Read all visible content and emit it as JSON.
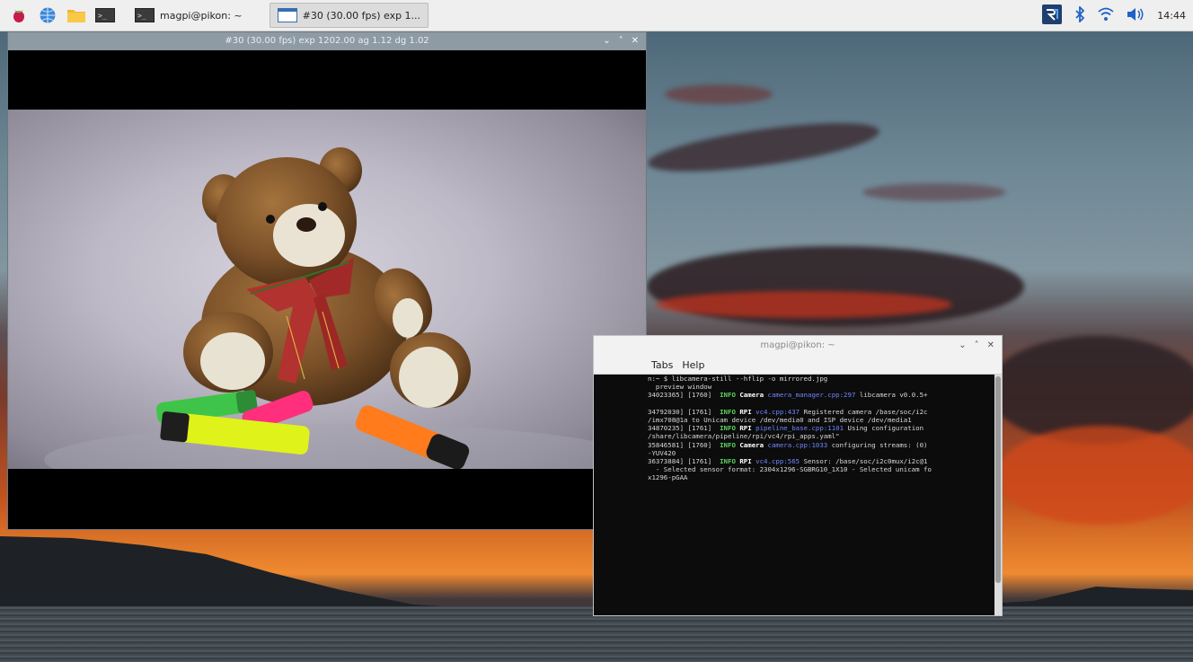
{
  "taskbar": {
    "icons": [
      "raspberry-menu-icon",
      "web-browser-icon",
      "file-manager-icon",
      "terminal-launcher-icon"
    ],
    "tasks": [
      {
        "label": "magpi@pikon: ~",
        "icon": "terminal-icon"
      },
      {
        "label": "#30 (30.00 fps) exp 1...",
        "icon": "window-icon"
      }
    ],
    "tray": {
      "vnc": "vnc-icon",
      "bluetooth": "bluetooth-icon",
      "wifi": "wifi-icon",
      "volume": "volume-icon"
    },
    "clock": "14:44"
  },
  "preview_window": {
    "title": "#30 (30.00 fps) exp 1202.00 ag 1.12 dg 1.02",
    "controls": [
      "⌄",
      "˄",
      "✕"
    ]
  },
  "terminal_window": {
    "title": "magpi@pikon: ~",
    "controls": [
      "⌄",
      "˄",
      "✕"
    ],
    "menu": [
      "Tabs",
      "Help"
    ],
    "lines": [
      {
        "parts": [
          {
            "t": "n:~ $ libcamera-still --hflip -o mirrored.jpg",
            "c": ""
          }
        ]
      },
      {
        "parts": [
          {
            "t": "  preview window",
            "c": ""
          }
        ]
      },
      {
        "parts": [
          {
            "t": "34023365] [1760]  ",
            "c": ""
          },
          {
            "t": "INFO ",
            "c": "c-grn"
          },
          {
            "t": "Camera ",
            "c": "c-wht"
          },
          {
            "t": "camera_manager.cpp:297 ",
            "c": "c-blu"
          },
          {
            "t": "libcamera v0.0.5+",
            "c": ""
          }
        ]
      },
      {
        "parts": [
          {
            "t": "",
            "c": ""
          }
        ]
      },
      {
        "parts": [
          {
            "t": "34792030] [1761]  ",
            "c": ""
          },
          {
            "t": "INFO ",
            "c": "c-grn"
          },
          {
            "t": "RPI ",
            "c": "c-wht"
          },
          {
            "t": "vc4.cpp:437 ",
            "c": "c-blu"
          },
          {
            "t": "Registered camera /base/soc/i2c",
            "c": ""
          }
        ]
      },
      {
        "parts": [
          {
            "t": "/imx708@1a to Unicam device /dev/media0 and ISP device /dev/media1",
            "c": ""
          }
        ]
      },
      {
        "parts": [
          {
            "t": "34870235] [1761]  ",
            "c": ""
          },
          {
            "t": "INFO ",
            "c": "c-grn"
          },
          {
            "t": "RPI ",
            "c": "c-wht"
          },
          {
            "t": "pipeline_base.cpp:1101 ",
            "c": "c-blu"
          },
          {
            "t": "Using configuration",
            "c": ""
          }
        ]
      },
      {
        "parts": [
          {
            "t": "/share/libcamera/pipeline/rpi/vc4/rpi_apps.yaml\"",
            "c": ""
          }
        ]
      },
      {
        "parts": [
          {
            "t": "35846581] [1760]  ",
            "c": ""
          },
          {
            "t": "INFO ",
            "c": "c-grn"
          },
          {
            "t": "Camera ",
            "c": "c-wht"
          },
          {
            "t": "camera.cpp:1033 ",
            "c": "c-blu"
          },
          {
            "t": "configuring streams: (0)",
            "c": ""
          }
        ]
      },
      {
        "parts": [
          {
            "t": "-YUV420",
            "c": ""
          }
        ]
      },
      {
        "parts": [
          {
            "t": "36373884] [1761]  ",
            "c": ""
          },
          {
            "t": "INFO ",
            "c": "c-grn"
          },
          {
            "t": "RPI ",
            "c": "c-wht"
          },
          {
            "t": "vc4.cpp:565 ",
            "c": "c-blu"
          },
          {
            "t": "Sensor: /base/soc/i2c0mux/i2c@1",
            "c": ""
          }
        ]
      },
      {
        "parts": [
          {
            "t": "  - Selected sensor format: 2304x1296-SGBRG10_1X10 - Selected unicam fo",
            "c": ""
          }
        ]
      },
      {
        "parts": [
          {
            "t": "x1296-pGAA",
            "c": ""
          }
        ]
      }
    ]
  }
}
